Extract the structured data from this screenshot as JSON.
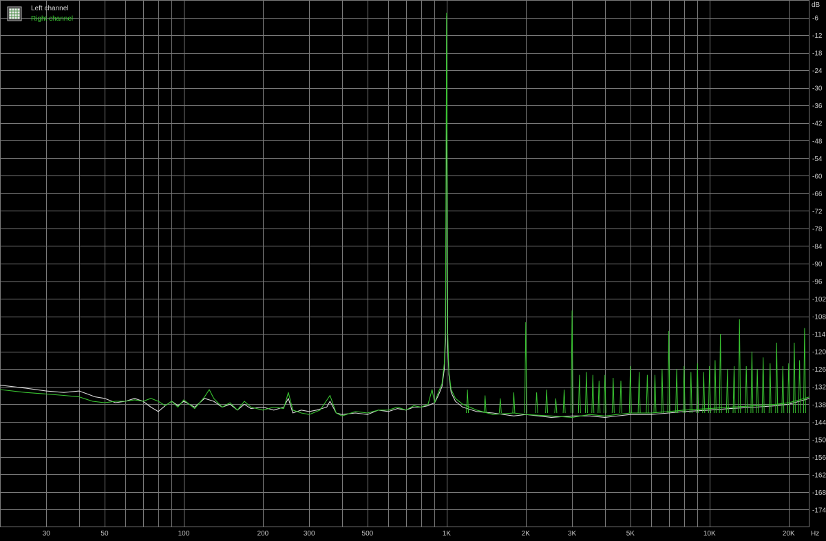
{
  "chart_data": {
    "type": "line",
    "x_scale": "log",
    "xlim": [
      20,
      24000
    ],
    "ylim": [
      -180,
      0
    ],
    "grid": true,
    "legend_placement": "top-left",
    "x_unit_label": "Hz",
    "y_unit_label": "dB",
    "x_ticks": [
      {
        "value": 30,
        "label": "30"
      },
      {
        "value": 50,
        "label": "50"
      },
      {
        "value": 100,
        "label": "100"
      },
      {
        "value": 200,
        "label": "200"
      },
      {
        "value": 300,
        "label": "300"
      },
      {
        "value": 500,
        "label": "500"
      },
      {
        "value": 1000,
        "label": "1K"
      },
      {
        "value": 2000,
        "label": "2K"
      },
      {
        "value": 3000,
        "label": "3K"
      },
      {
        "value": 5000,
        "label": "5K"
      },
      {
        "value": 10000,
        "label": "10K"
      },
      {
        "value": 20000,
        "label": "20K"
      }
    ],
    "x_gridlines": [
      20,
      30,
      40,
      50,
      60,
      70,
      80,
      90,
      100,
      200,
      300,
      400,
      500,
      600,
      700,
      800,
      900,
      1000,
      2000,
      3000,
      4000,
      5000,
      6000,
      7000,
      8000,
      9000,
      10000,
      20000
    ],
    "y_ticks": [
      -6,
      -12,
      -18,
      -24,
      -30,
      -36,
      -42,
      -48,
      -54,
      -60,
      -66,
      -72,
      -78,
      -84,
      -90,
      -96,
      -102,
      -108,
      -114,
      -120,
      -126,
      -132,
      -138,
      -144,
      -150,
      -156,
      -162,
      -168,
      -174
    ],
    "colors": {
      "background": "#000000",
      "grid": "#7a7a7a",
      "left": "#d8d8d8",
      "right": "#39c431",
      "tick_text": "#c8c8c8"
    },
    "series": [
      {
        "name": "Left channel",
        "color": "#d8d8d8",
        "points": [
          [
            20,
            -131.5
          ],
          [
            25,
            -132.5
          ],
          [
            30,
            -133.5
          ],
          [
            35,
            -134
          ],
          [
            40,
            -133.5
          ],
          [
            43,
            -134.5
          ],
          [
            46,
            -135.5
          ],
          [
            50,
            -136
          ],
          [
            55,
            -137.5
          ],
          [
            60,
            -137
          ],
          [
            65,
            -136
          ],
          [
            70,
            -137
          ],
          [
            75,
            -139
          ],
          [
            80,
            -140.5
          ],
          [
            85,
            -138.5
          ],
          [
            90,
            -137
          ],
          [
            95,
            -138.5
          ],
          [
            100,
            -137
          ],
          [
            110,
            -139
          ],
          [
            120,
            -136
          ],
          [
            130,
            -137
          ],
          [
            140,
            -139
          ],
          [
            150,
            -138
          ],
          [
            160,
            -140
          ],
          [
            170,
            -138
          ],
          [
            180,
            -139.5
          ],
          [
            200,
            -139
          ],
          [
            220,
            -140
          ],
          [
            240,
            -139
          ],
          [
            250,
            -136
          ],
          [
            260,
            -141
          ],
          [
            280,
            -140
          ],
          [
            300,
            -140.5
          ],
          [
            320,
            -140
          ],
          [
            350,
            -139
          ],
          [
            360,
            -137
          ],
          [
            380,
            -141
          ],
          [
            400,
            -141.5
          ],
          [
            450,
            -141
          ],
          [
            500,
            -141.5
          ],
          [
            550,
            -140
          ],
          [
            600,
            -140.5
          ],
          [
            650,
            -139.5
          ],
          [
            700,
            -140
          ],
          [
            750,
            -139
          ],
          [
            800,
            -139
          ],
          [
            850,
            -138.5
          ],
          [
            900,
            -137.5
          ],
          [
            930,
            -135
          ],
          [
            960,
            -132
          ],
          [
            980,
            -126
          ],
          [
            990,
            -116
          ],
          [
            995,
            -80
          ],
          [
            1000,
            -5.5
          ],
          [
            1005,
            -80
          ],
          [
            1010,
            -118
          ],
          [
            1020,
            -128
          ],
          [
            1040,
            -134
          ],
          [
            1080,
            -137
          ],
          [
            1150,
            -139
          ],
          [
            1300,
            -140.5
          ],
          [
            1500,
            -141
          ],
          [
            1800,
            -142
          ],
          [
            2000,
            -141.5
          ],
          [
            2500,
            -142.5
          ],
          [
            3000,
            -142
          ],
          [
            3500,
            -142
          ],
          [
            4000,
            -142.5
          ],
          [
            5000,
            -141.5
          ],
          [
            6000,
            -141.5
          ],
          [
            7000,
            -141
          ],
          [
            8000,
            -140.5
          ],
          [
            10000,
            -140
          ],
          [
            12000,
            -139.5
          ],
          [
            15000,
            -139
          ],
          [
            18000,
            -138.5
          ],
          [
            20000,
            -138
          ],
          [
            22000,
            -137
          ],
          [
            24000,
            -136
          ]
        ]
      },
      {
        "name": "Right channel",
        "color": "#39c431",
        "points": [
          [
            20,
            -133
          ],
          [
            25,
            -134
          ],
          [
            30,
            -134.5
          ],
          [
            35,
            -135
          ],
          [
            40,
            -135.5
          ],
          [
            45,
            -137
          ],
          [
            50,
            -137.5
          ],
          [
            55,
            -137
          ],
          [
            60,
            -137
          ],
          [
            65,
            -136.5
          ],
          [
            70,
            -137
          ],
          [
            75,
            -136
          ],
          [
            80,
            -137
          ],
          [
            85,
            -138.5
          ],
          [
            90,
            -137
          ],
          [
            95,
            -139
          ],
          [
            100,
            -136.5
          ],
          [
            110,
            -139.5
          ],
          [
            120,
            -135.5
          ],
          [
            125,
            -133
          ],
          [
            130,
            -136
          ],
          [
            140,
            -139
          ],
          [
            150,
            -137.5
          ],
          [
            160,
            -140
          ],
          [
            170,
            -137
          ],
          [
            180,
            -139
          ],
          [
            200,
            -140
          ],
          [
            220,
            -139
          ],
          [
            240,
            -139.5
          ],
          [
            250,
            -134
          ],
          [
            260,
            -140
          ],
          [
            280,
            -141
          ],
          [
            300,
            -141.5
          ],
          [
            330,
            -140
          ],
          [
            360,
            -135
          ],
          [
            380,
            -141
          ],
          [
            400,
            -142
          ],
          [
            450,
            -140.5
          ],
          [
            500,
            -141
          ],
          [
            550,
            -140
          ],
          [
            600,
            -140
          ],
          [
            650,
            -139
          ],
          [
            700,
            -140
          ],
          [
            750,
            -138.5
          ],
          [
            800,
            -139
          ],
          [
            850,
            -138
          ],
          [
            880,
            -133
          ],
          [
            900,
            -137.5
          ],
          [
            930,
            -134
          ],
          [
            960,
            -131
          ],
          [
            980,
            -124
          ],
          [
            990,
            -112
          ],
          [
            995,
            -60
          ],
          [
            1000,
            -4.5
          ],
          [
            1005,
            -60
          ],
          [
            1010,
            -114
          ],
          [
            1020,
            -127
          ],
          [
            1040,
            -133
          ],
          [
            1080,
            -136
          ],
          [
            1150,
            -138
          ],
          [
            1300,
            -140
          ],
          [
            1500,
            -141.5
          ],
          [
            1800,
            -141
          ],
          [
            2000,
            -141.5
          ],
          [
            2500,
            -142
          ],
          [
            3000,
            -142.5
          ],
          [
            3500,
            -141.5
          ],
          [
            4000,
            -142
          ],
          [
            5000,
            -141
          ],
          [
            6000,
            -141
          ],
          [
            7000,
            -140.5
          ],
          [
            8000,
            -140
          ],
          [
            10000,
            -139.5
          ],
          [
            12000,
            -139
          ],
          [
            15000,
            -138.5
          ],
          [
            18000,
            -138
          ],
          [
            20000,
            -137.5
          ],
          [
            22000,
            -136.5
          ],
          [
            24000,
            -135.5
          ]
        ]
      }
    ],
    "harmonic_spurs": [
      [
        1200,
        -133
      ],
      [
        1400,
        -135
      ],
      [
        1600,
        -136
      ],
      [
        1800,
        -134
      ],
      [
        2000,
        -110
      ],
      [
        2200,
        -134
      ],
      [
        2400,
        -133
      ],
      [
        2600,
        -136
      ],
      [
        2800,
        -133
      ],
      [
        3000,
        -106
      ],
      [
        3200,
        -128
      ],
      [
        3400,
        -127
      ],
      [
        3600,
        -128
      ],
      [
        3800,
        -130
      ],
      [
        4000,
        -128
      ],
      [
        4300,
        -129
      ],
      [
        4600,
        -130
      ],
      [
        5000,
        -125
      ],
      [
        5400,
        -127
      ],
      [
        5800,
        -128
      ],
      [
        6200,
        -128
      ],
      [
        6600,
        -126
      ],
      [
        7000,
        -113
      ],
      [
        7500,
        -126
      ],
      [
        8000,
        -125
      ],
      [
        8500,
        -127
      ],
      [
        9000,
        -124
      ],
      [
        9500,
        -127
      ],
      [
        10000,
        -125
      ],
      [
        10500,
        -123
      ],
      [
        11000,
        -114
      ],
      [
        11700,
        -126
      ],
      [
        12400,
        -125
      ],
      [
        13000,
        -109
      ],
      [
        13800,
        -125
      ],
      [
        14500,
        -120
      ],
      [
        15200,
        -126
      ],
      [
        16000,
        -122
      ],
      [
        17000,
        -124
      ],
      [
        18000,
        -117
      ],
      [
        19000,
        -125
      ],
      [
        20000,
        -124
      ],
      [
        21000,
        -117
      ],
      [
        22000,
        -123
      ],
      [
        23000,
        -112
      ]
    ]
  },
  "legend": {
    "icon": "grid-icon",
    "items": [
      {
        "label": "Left channel",
        "color": "#d8d8d8"
      },
      {
        "label": "Right channel",
        "color": "#39c431"
      }
    ]
  }
}
